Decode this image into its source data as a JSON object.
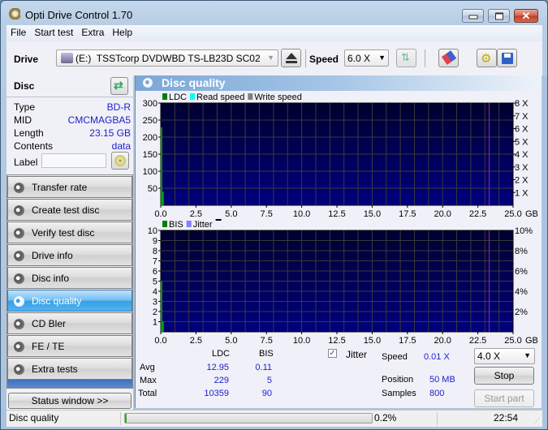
{
  "window": {
    "title": "Opti Drive Control 1.70",
    "controls": {
      "minimize": "minimize-icon",
      "maximize": "maximize-icon",
      "close": "close-icon"
    }
  },
  "menu": [
    "File",
    "Start test",
    "Extra",
    "Help"
  ],
  "toolbar": {
    "drive_label": "Drive",
    "drive_value": "(E:)  TSSTcorp DVDWBD TS-LB23D SC02",
    "speed_label": "Speed",
    "speed_value": "6.0 X",
    "icons": [
      "eject-icon",
      "refresh-speeds-icon",
      "erase-icon",
      "settings-icon",
      "save-icon"
    ]
  },
  "disc": {
    "heading": "Disc",
    "fields": [
      {
        "label": "Type",
        "value": "BD-R"
      },
      {
        "label": "MID",
        "value": "CMCMAGBA5"
      },
      {
        "label": "Length",
        "value": "23.15 GB"
      },
      {
        "label": "Contents",
        "value": "data"
      }
    ],
    "label_field": {
      "label": "Label",
      "value": ""
    }
  },
  "nav": [
    {
      "label": "Transfer rate",
      "active": false
    },
    {
      "label": "Create test disc",
      "active": false
    },
    {
      "label": "Verify test disc",
      "active": false
    },
    {
      "label": "Drive info",
      "active": false
    },
    {
      "label": "Disc info",
      "active": false
    },
    {
      "label": "Disc quality",
      "active": true
    },
    {
      "label": "CD Bler",
      "active": false
    },
    {
      "label": "FE / TE",
      "active": false
    },
    {
      "label": "Extra tests",
      "active": false
    }
  ],
  "status_window_button": "Status window >>",
  "panel": {
    "title": "Disc quality"
  },
  "chart_data": [
    {
      "type": "bar",
      "title": "LDC",
      "legend": [
        {
          "name": "LDC",
          "color": "#008000"
        },
        {
          "name": "Read speed",
          "color": "#00ffff"
        },
        {
          "name": "Write speed",
          "color": "#808080"
        }
      ],
      "legend_position": "top-left",
      "x_ticks": [
        "0.0",
        "2.5",
        "5.0",
        "7.5",
        "10.0",
        "12.5",
        "15.0",
        "17.5",
        "20.0",
        "22.5",
        "25.0"
      ],
      "x_unit": "GB",
      "xlim": [
        0,
        25
      ],
      "y_ticks": [
        "50",
        "100",
        "150",
        "200",
        "250",
        "300"
      ],
      "ylim": [
        0,
        300
      ],
      "y2_ticks": [
        "1 X",
        "2 X",
        "3 X",
        "4 X",
        "5 X",
        "6 X",
        "7 X",
        "8 X"
      ],
      "y2lim": [
        0,
        8
      ],
      "grid": true,
      "series": [
        {
          "name": "LDC",
          "x": [
            0.0,
            0.05
          ],
          "values": [
            229,
            40
          ]
        }
      ],
      "marker_line_x": 23.3
    },
    {
      "type": "bar",
      "title": "BIS",
      "legend": [
        {
          "name": "BIS",
          "color": "#008000"
        },
        {
          "name": "Jitter",
          "color": "#8080ff"
        }
      ],
      "legend_position": "top-left",
      "x_ticks": [
        "0.0",
        "2.5",
        "5.0",
        "7.5",
        "10.0",
        "12.5",
        "15.0",
        "17.5",
        "20.0",
        "22.5",
        "25.0"
      ],
      "x_unit": "GB",
      "xlim": [
        0,
        25
      ],
      "y_ticks": [
        "1",
        "2",
        "3",
        "4",
        "5",
        "6",
        "7",
        "8",
        "9",
        "10"
      ],
      "ylim": [
        0,
        10
      ],
      "y2_ticks": [
        "2%",
        "4%",
        "6%",
        "8%",
        "10%"
      ],
      "y2lim": [
        0,
        10
      ],
      "grid": true,
      "series": [
        {
          "name": "BIS",
          "x": [
            0.0,
            0.05
          ],
          "values": [
            5,
            1
          ]
        }
      ],
      "marker_line_x": 23.3
    }
  ],
  "stats": {
    "columns": [
      "LDC",
      "BIS"
    ],
    "rows": [
      {
        "label": "Avg",
        "ldc": "12.95",
        "bis": "0.11"
      },
      {
        "label": "Max",
        "ldc": "229",
        "bis": "5"
      },
      {
        "label": "Total",
        "ldc": "10359",
        "bis": "90"
      }
    ],
    "jitter_label": "Jitter",
    "jitter_checked": true
  },
  "run": {
    "speed_label": "Speed",
    "speed_value": "0.01 X",
    "position_label": "Position",
    "position_value": "50 MB",
    "samples_label": "Samples",
    "samples_value": "800",
    "speed_select": "4.0 X",
    "stop_button": "Stop",
    "start_part_button": "Start part"
  },
  "statusbar": {
    "text": "Disc quality",
    "progress_percent": 0.2,
    "progress_label": "0.2%",
    "time": "22:54"
  }
}
